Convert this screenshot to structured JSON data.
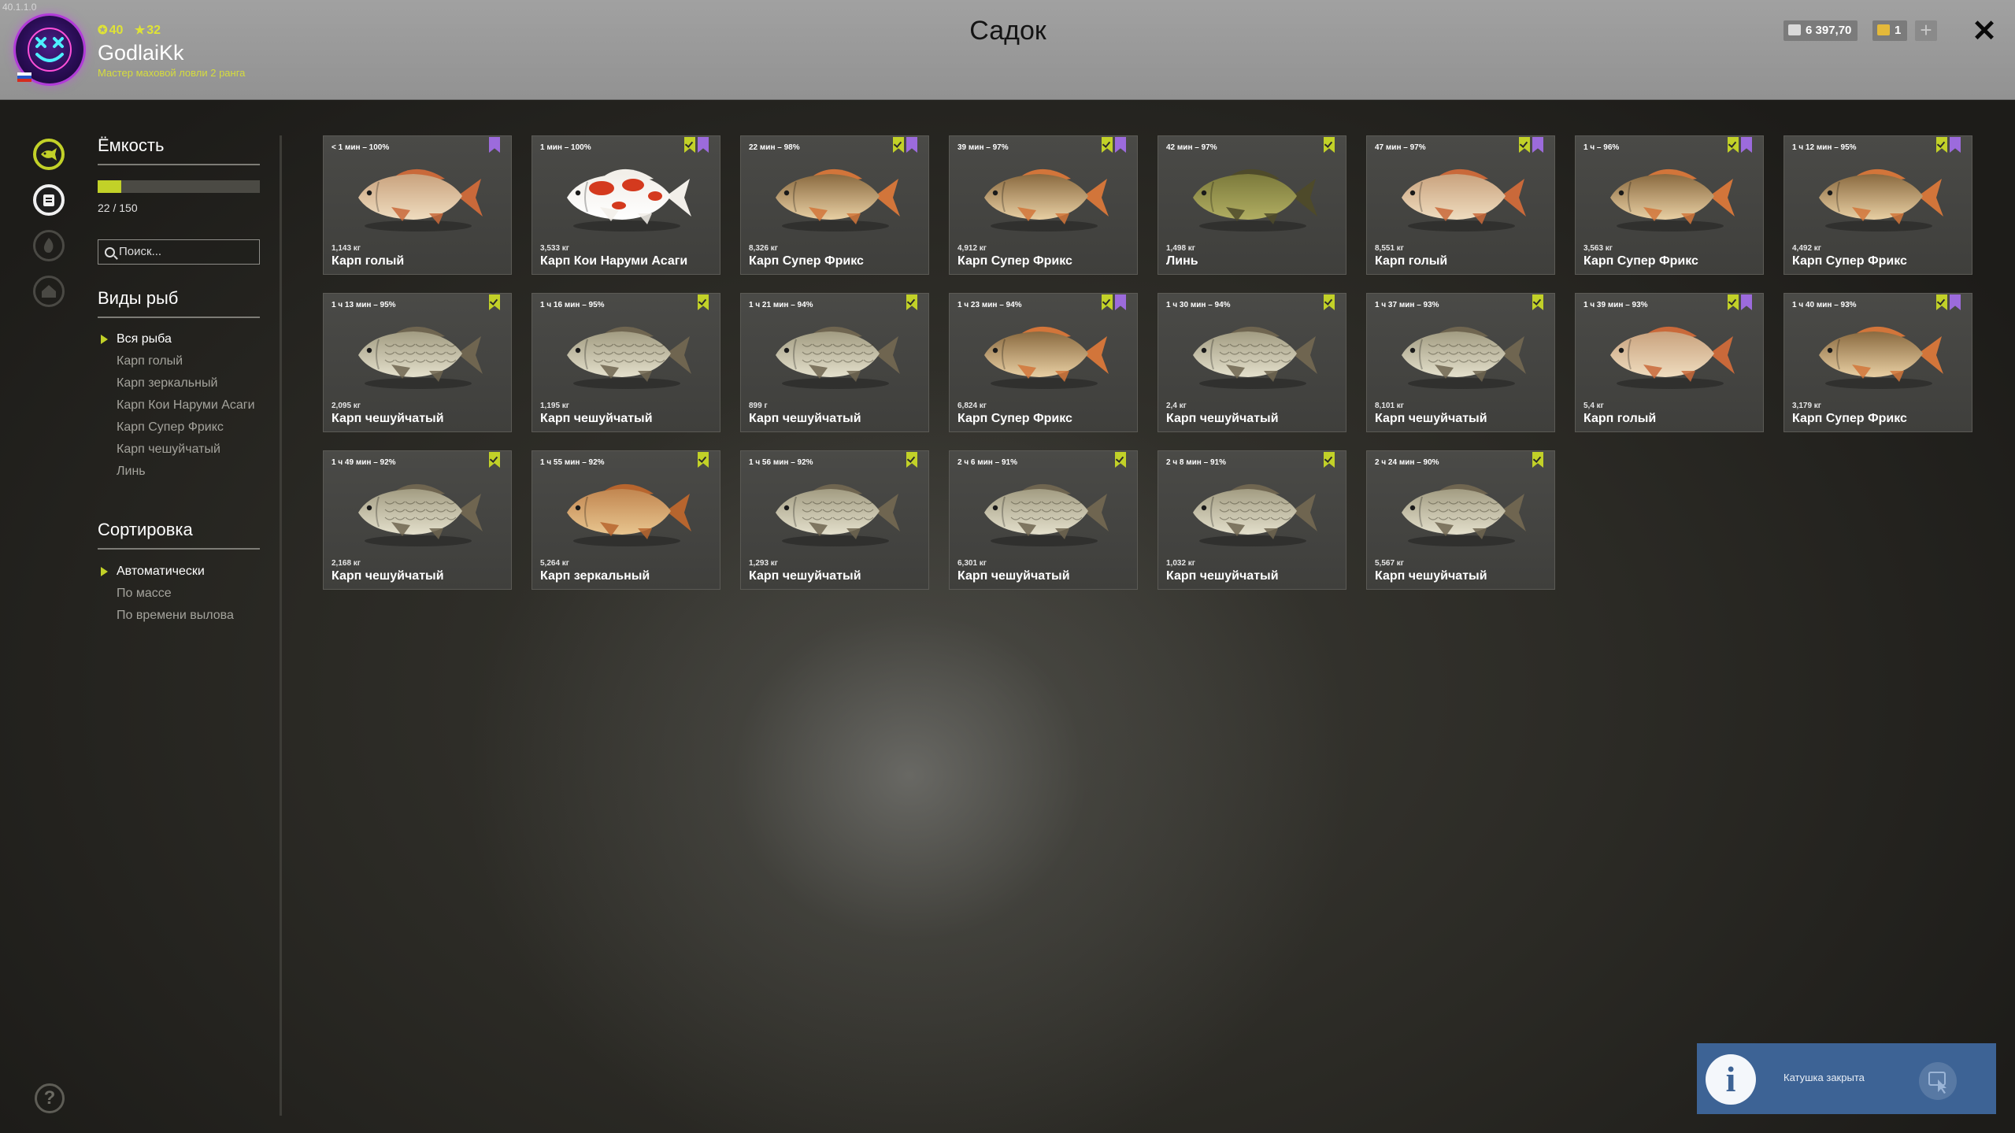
{
  "app": {
    "version": "40.1.1.0"
  },
  "header": {
    "title": "Садок",
    "player": {
      "name": "GodlaiKk",
      "title": "Мастер маховой ловли 2 ранга",
      "level": "40",
      "rank": "32"
    },
    "balance": {
      "silver": "6 397,70",
      "gold": "1"
    },
    "plus_label": "+",
    "close_label": "✕"
  },
  "sidebar": {
    "capacity_heading": "Ёмкость",
    "capacity_text": "22 / 150",
    "capacity_fill": 0.147,
    "search_placeholder": "Поиск...",
    "species_heading": "Виды рыб",
    "species": [
      "Вся рыба",
      "Карп голый",
      "Карп зеркальный",
      "Карп Кои Наруми Асаги",
      "Карп Супер Фрикс",
      "Карп чешуйчатый",
      "Линь"
    ],
    "species_selected": 0,
    "sort_heading": "Сортировка",
    "sort_options": [
      "Автоматически",
      "По массе",
      "По времени вылова"
    ],
    "sort_selected": 0,
    "help_label": "?"
  },
  "fish": [
    {
      "time": "< 1 мин – 100%",
      "weight": "1,143 кг",
      "name": "Карп голый",
      "marks": [
        "p"
      ],
      "kind": "naked"
    },
    {
      "time": "1 мин – 100%",
      "weight": "3,533 кг",
      "name": "Карп Кои Наруми Асаги",
      "marks": [
        "g",
        "p"
      ],
      "kind": "koi"
    },
    {
      "time": "22 мин – 98%",
      "weight": "8,326 кг",
      "name": "Карп Супер Фрикс",
      "marks": [
        "g",
        "p"
      ],
      "kind": "frix"
    },
    {
      "time": "39 мин – 97%",
      "weight": "4,912 кг",
      "name": "Карп Супер Фрикс",
      "marks": [
        "g",
        "p"
      ],
      "kind": "frix"
    },
    {
      "time": "42 мин – 97%",
      "weight": "1,498 кг",
      "name": "Линь",
      "marks": [
        "g"
      ],
      "kind": "tench"
    },
    {
      "time": "47 мин – 97%",
      "weight": "8,551 кг",
      "name": "Карп голый",
      "marks": [
        "g",
        "p"
      ],
      "kind": "naked"
    },
    {
      "time": "1 ч – 96%",
      "weight": "3,563 кг",
      "name": "Карп Супер Фрикс",
      "marks": [
        "g",
        "p"
      ],
      "kind": "frix"
    },
    {
      "time": "1 ч 12 мин – 95%",
      "weight": "4,492 кг",
      "name": "Карп Супер Фрикс",
      "marks": [
        "g",
        "p"
      ],
      "kind": "frix"
    },
    {
      "time": "1 ч 13 мин – 95%",
      "weight": "2,095 кг",
      "name": "Карп чешуйчатый",
      "marks": [
        "g"
      ],
      "kind": "scaly"
    },
    {
      "time": "1 ч 16 мин – 95%",
      "weight": "1,195 кг",
      "name": "Карп чешуйчатый",
      "marks": [
        "g"
      ],
      "kind": "scaly"
    },
    {
      "time": "1 ч 21 мин – 94%",
      "weight": "899 г",
      "name": "Карп чешуйчатый",
      "marks": [
        "g"
      ],
      "kind": "scaly"
    },
    {
      "time": "1 ч 23 мин – 94%",
      "weight": "6,824 кг",
      "name": "Карп Супер Фрикс",
      "marks": [
        "g",
        "p"
      ],
      "kind": "frix"
    },
    {
      "time": "1 ч 30 мин – 94%",
      "weight": "2,4 кг",
      "name": "Карп чешуйчатый",
      "marks": [
        "g"
      ],
      "kind": "scaly"
    },
    {
      "time": "1 ч 37 мин – 93%",
      "weight": "8,101 кг",
      "name": "Карп чешуйчатый",
      "marks": [
        "g"
      ],
      "kind": "scaly"
    },
    {
      "time": "1 ч 39 мин – 93%",
      "weight": "5,4 кг",
      "name": "Карп голый",
      "marks": [
        "g",
        "p"
      ],
      "kind": "naked"
    },
    {
      "time": "1 ч 40 мин – 93%",
      "weight": "3,179 кг",
      "name": "Карп Супер Фрикс",
      "marks": [
        "g",
        "p"
      ],
      "kind": "frix"
    },
    {
      "time": "1 ч 49 мин – 92%",
      "weight": "2,168 кг",
      "name": "Карп чешуйчатый",
      "marks": [
        "g"
      ],
      "kind": "scaly"
    },
    {
      "time": "1 ч 55 мин – 92%",
      "weight": "5,264 кг",
      "name": "Карп зеркальный",
      "marks": [
        "g"
      ],
      "kind": "mirror"
    },
    {
      "time": "1 ч 56 мин – 92%",
      "weight": "1,293 кг",
      "name": "Карп чешуйчатый",
      "marks": [
        "g"
      ],
      "kind": "scaly"
    },
    {
      "time": "2 ч 6 мин – 91%",
      "weight": "6,301 кг",
      "name": "Карп чешуйчатый",
      "marks": [
        "g"
      ],
      "kind": "scaly"
    },
    {
      "time": "2 ч 8 мин – 91%",
      "weight": "1,032 кг",
      "name": "Карп чешуйчатый",
      "marks": [
        "g"
      ],
      "kind": "scaly"
    },
    {
      "time": "2 ч 24 мин – 90%",
      "weight": "5,567 кг",
      "name": "Карп чешуйчатый",
      "marks": [
        "g"
      ],
      "kind": "scaly"
    }
  ],
  "fish_palettes": {
    "naked": {
      "body": "#c9a27e",
      "belly": "#efdcbf",
      "fin": "#c9693a"
    },
    "koi": {
      "body": "#f2efe9",
      "belly": "#ffffff",
      "fin": "#f2efe9",
      "spot": "#d43a1e"
    },
    "frix": {
      "body": "#8a6a40",
      "belly": "#e8cfa3",
      "fin": "#d2753a"
    },
    "tench": {
      "body": "#7c7a3c",
      "belly": "#b1ae62",
      "fin": "#4e4a2a"
    },
    "scaly": {
      "body": "#a29c82",
      "belly": "#e4e0cc",
      "fin": "#6f6550"
    },
    "mirror": {
      "body": "#c18650",
      "belly": "#e8c58f",
      "fin": "#b7652e"
    }
  },
  "notification": {
    "text": "Катушка закрыта",
    "icon": "info-icon"
  },
  "colors": {
    "accent": "#c2d128",
    "trophy_mark": "#9c6bdc",
    "header_bg": "#9b9b9b"
  }
}
